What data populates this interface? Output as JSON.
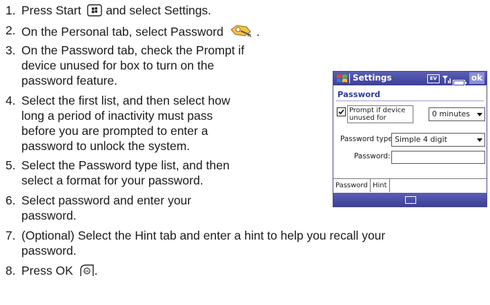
{
  "steps": [
    {
      "num": "1.",
      "lines": [
        "Press Start",
        "and select Settings."
      ]
    },
    {
      "num": "2.",
      "lines": [
        "On the Personal tab, select Password"
      ]
    },
    {
      "num": "3.",
      "lines": [
        "On the Password tab, check the Prompt if",
        "device unused for box to turn on the",
        "password feature."
      ]
    },
    {
      "num": "4.",
      "lines": [
        "Select the first list, and then select how",
        "long a period of inactivity must pass",
        "before you are prompted to enter a",
        "password to unlock the system."
      ]
    },
    {
      "num": "5.",
      "lines": [
        "Select the Password type list, and then",
        "select a format for your password."
      ]
    },
    {
      "num": "6.",
      "lines": [
        "Select password and enter your",
        "password."
      ]
    },
    {
      "num": "7.",
      "lines": [
        "(Optional) Select the Hint tab and enter a hint to help you recall your",
        "password."
      ]
    },
    {
      "num": "8.",
      "lines": [
        "Press OK",
        "."
      ]
    }
  ],
  "device": {
    "title": "Settings",
    "status_ev": "EV",
    "ok_label": "ok",
    "section_title": "Password",
    "prompt_label": "Prompt if device unused for",
    "prompt_checked": true,
    "prompt_value": "0 minutes",
    "password_type_label": "Password type:",
    "password_type_value": "Simple 4 digit",
    "password_label": "Password:",
    "password_value": "",
    "tabs": [
      "Password",
      "Hint"
    ],
    "colors": {
      "titlebar": "#3d3f97",
      "accent": "#2e3a9a"
    }
  },
  "icons": {
    "start": "windows-start-button-icon",
    "password": "password-keys-icon",
    "ok_button": "ok-hard-button-icon"
  }
}
